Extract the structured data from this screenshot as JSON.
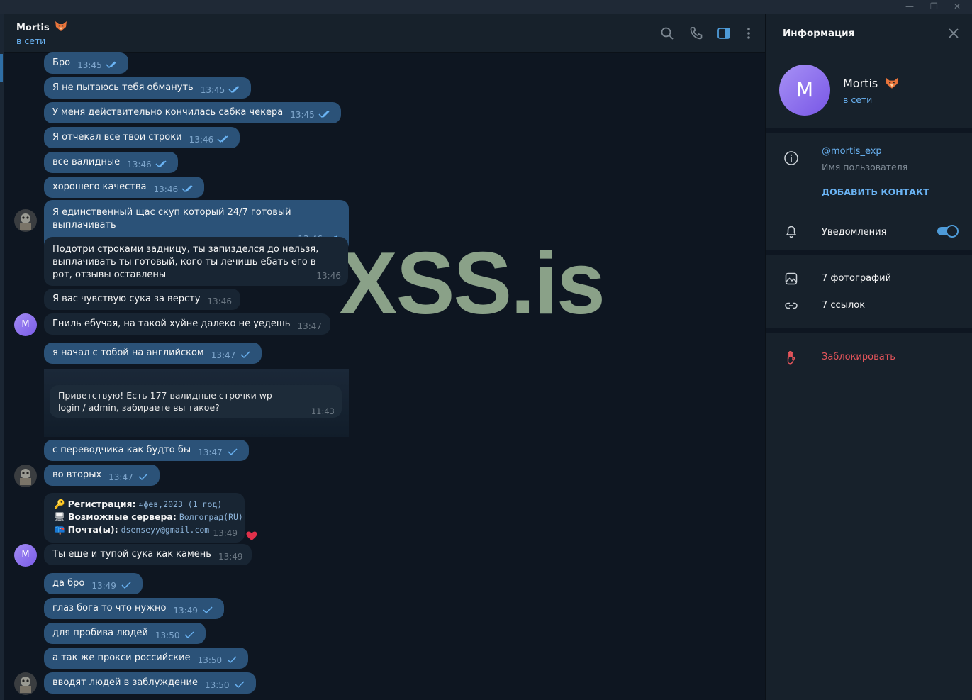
{
  "window": {
    "controls": [
      "—",
      "❐",
      "✕"
    ]
  },
  "chat": {
    "peer_name": "Mortis",
    "peer_status": "в сети",
    "header_icons": [
      "search-icon",
      "phone-icon",
      "sidebar-toggle-icon",
      "more-vert-icon"
    ]
  },
  "watermark": "XSS.is",
  "messages": [
    {
      "text": "Бро",
      "time": "13:45",
      "status": "read"
    },
    {
      "text": "Я не пытаюсь тебя обмануть",
      "time": "13:45",
      "status": "read"
    },
    {
      "text": "У меня действительно кончилась сабка чекера",
      "time": "13:45",
      "status": "read"
    },
    {
      "text": "Я отчекал все твои строки",
      "time": "13:46",
      "status": "read"
    },
    {
      "text": "все валидные",
      "time": "13:46",
      "status": "read"
    },
    {
      "text": "хорошего качества",
      "time": "13:46",
      "status": "read"
    },
    {
      "text": "Я единственный щас скуп который 24/7 готовый выплачивать",
      "time": "13:46",
      "status": "read"
    },
    {
      "text": "Подотри строками задницу, ты запизделся до нельзя, выплачивать ты готовый, кого ты лечишь ебать его в рот, отзывы оставлены",
      "time": "13:46"
    },
    {
      "text": "Я вас чувствую сука за версту",
      "time": "13:46"
    },
    {
      "text": "Гниль ебучая, на такой хуйне далеко не уедешь",
      "time": "13:47"
    },
    {
      "text": "я начал с тобой на английском",
      "time": "13:47",
      "status": "sent"
    },
    {
      "text": "с переводчика как будто бы",
      "time": "13:47",
      "status": "sent"
    },
    {
      "text": "во вторых",
      "time": "13:47",
      "status": "sent"
    },
    {
      "text": "Ты еще и тупой сука как камень",
      "time": "13:49"
    },
    {
      "text": "да бро",
      "time": "13:49",
      "status": "sent"
    },
    {
      "text": "глаз бога то что нужно",
      "time": "13:49",
      "status": "sent"
    },
    {
      "text": "для пробива людей",
      "time": "13:50",
      "status": "sent"
    },
    {
      "text": "а так же прокси российские",
      "time": "13:50",
      "status": "sent"
    },
    {
      "text": "вводят людей в заблуждение",
      "time": "13:50",
      "status": "sent"
    }
  ],
  "forwarded": {
    "text": "Приветствую! Есть 177 валидные строчки wp-login / admin, забираете вы такое?",
    "time": "11:43"
  },
  "registration": {
    "reg_label": "Регистрация:",
    "reg_value": "≈фев,2023 (1 год)",
    "servers_label": "Возможные сервера:",
    "servers_value": "Волгоград(RU)",
    "mail_label": "Почта(ы):",
    "mail_value": "dsenseyy@gmail.com",
    "time": "13:49",
    "reaction": "heart"
  },
  "info": {
    "title": "Информация",
    "avatar_letter": "M",
    "name": "Mortis",
    "status": "в сети",
    "username": "@mortis_exp",
    "username_label": "Имя пользователя",
    "add_contact": "ДОБАВИТЬ КОНТАКТ",
    "notifications": "Уведомления",
    "notifications_on": true,
    "photos": "7 фотографий",
    "links": "7 ссылок",
    "block": "Заблокировать"
  },
  "colors": {
    "accent": "#6ab3f3",
    "outgoing": "#2b5278",
    "incoming": "#182533",
    "danger": "#e5555b"
  }
}
